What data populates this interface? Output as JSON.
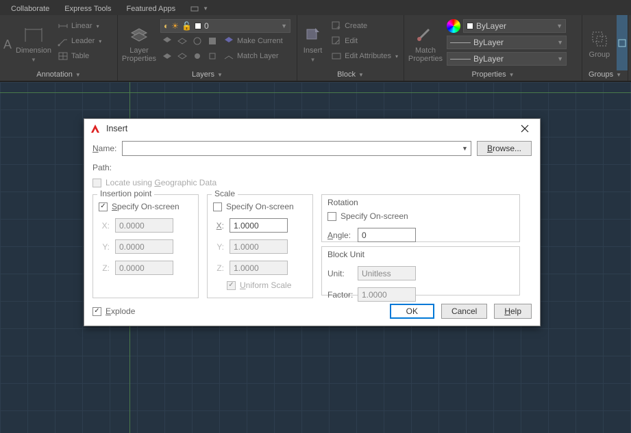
{
  "tabs": {
    "t1": "Collaborate",
    "t2": "Express Tools",
    "t3": "Featured Apps"
  },
  "annotation": {
    "panel_title": "Annotation",
    "dimension": "Dimension",
    "linear": "Linear",
    "leader": "Leader",
    "table": "Table"
  },
  "layers": {
    "panel_title": "Layers",
    "properties": "Layer\nProperties",
    "make_current": "Make Current",
    "match_layer": "Match Layer",
    "current": "0"
  },
  "block": {
    "panel_title": "Block",
    "insert": "Insert",
    "create": "Create",
    "edit": "Edit",
    "edit_attr": "Edit Attributes"
  },
  "properties": {
    "panel_title": "Properties",
    "match": "Match\nProperties",
    "bylayer1": "ByLayer",
    "bylayer2": "ByLayer",
    "bylayer3": "ByLayer"
  },
  "groups": {
    "panel_title": "Groups",
    "group": "Group"
  },
  "dialog": {
    "title": "Insert",
    "name_label": "Name:",
    "name_u": "N",
    "browse": "Browse...",
    "browse_u": "B",
    "path_label": "Path:",
    "geo": "Locate using Geographic Data",
    "geo_u": "G",
    "insertion": {
      "title": "Insertion point",
      "specify": "Specify On-screen",
      "specify_u": "S",
      "x": "X:",
      "y": "Y:",
      "z": "Z:",
      "xv": "0.0000",
      "yv": "0.0000",
      "zv": "0.0000"
    },
    "scale": {
      "title": "Scale",
      "specify": "Specify On-screen",
      "x": "X:",
      "y": "Y:",
      "z": "Z:",
      "xv": "1.0000",
      "yv": "1.0000",
      "zv": "1.0000",
      "uniform": "Uniform Scale",
      "uniform_u": "U"
    },
    "rotation": {
      "title": "Rotation",
      "specify": "Specify On-screen",
      "angle": "Angle:",
      "angle_u": "A",
      "anglev": "0"
    },
    "blockunit": {
      "title": "Block Unit",
      "unit": "Unit:",
      "unitv": "Unitless",
      "factor": "Factor:",
      "factorv": "1.0000"
    },
    "explode": "Explode",
    "explode_u": "E",
    "ok": "OK",
    "cancel": "Cancel",
    "help": "Help",
    "help_u": "H"
  }
}
